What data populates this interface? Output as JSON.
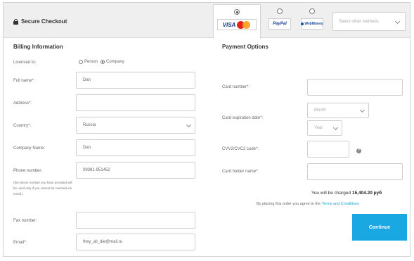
{
  "header": {
    "secure_title": "Secure Checkout",
    "payment_methods": [
      {
        "name": "card",
        "label": "VISA",
        "selected": true
      },
      {
        "name": "paypal",
        "label": "PayPal",
        "selected": false
      },
      {
        "name": "webmoney",
        "label": "WebMoney",
        "selected": false
      }
    ],
    "select_other": "Select other methods"
  },
  "billing": {
    "title": "Billing Information",
    "licensed_to_label": "Licensed to:",
    "licensed_options": [
      "Person",
      "Company"
    ],
    "licensed_selected": "Company",
    "full_name_label": "Full name*:",
    "full_name_value": "Dan",
    "address_label": "Address*:",
    "address_value": "",
    "country_label": "Country*:",
    "country_value": "Russia",
    "company_label": "Company Name:",
    "company_value": "Dan",
    "phone_label": "Phone number:",
    "phone_value": "09381-951452",
    "phone_note": "(the phone number you have provided will be used only if you cannot be reached via email.)",
    "fax_label": "Fax number:",
    "fax_value": "",
    "email_label": "Email*:",
    "email_value": "they_all_die@mail.ru"
  },
  "payment": {
    "title": "Payment Options",
    "card_number_label": "Card number*:",
    "card_number_value": "",
    "expiry_label": "Card expiration date*:",
    "month_placeholder": "Month",
    "year_placeholder": "Year",
    "cvv_label": "CVV2/CVC2 code*:",
    "cvv_value": "",
    "holder_label": "Card holder name*:",
    "holder_value": "",
    "charged_prefix": "You will be charged",
    "charged_amount": "15,404.20 руб",
    "agree_text": "By placing this order you agree to the",
    "terms_link": "Terms and Conditions",
    "continue_label": "Continue"
  },
  "colors": {
    "accent": "#19a8e2",
    "topbar": "#efefef"
  }
}
